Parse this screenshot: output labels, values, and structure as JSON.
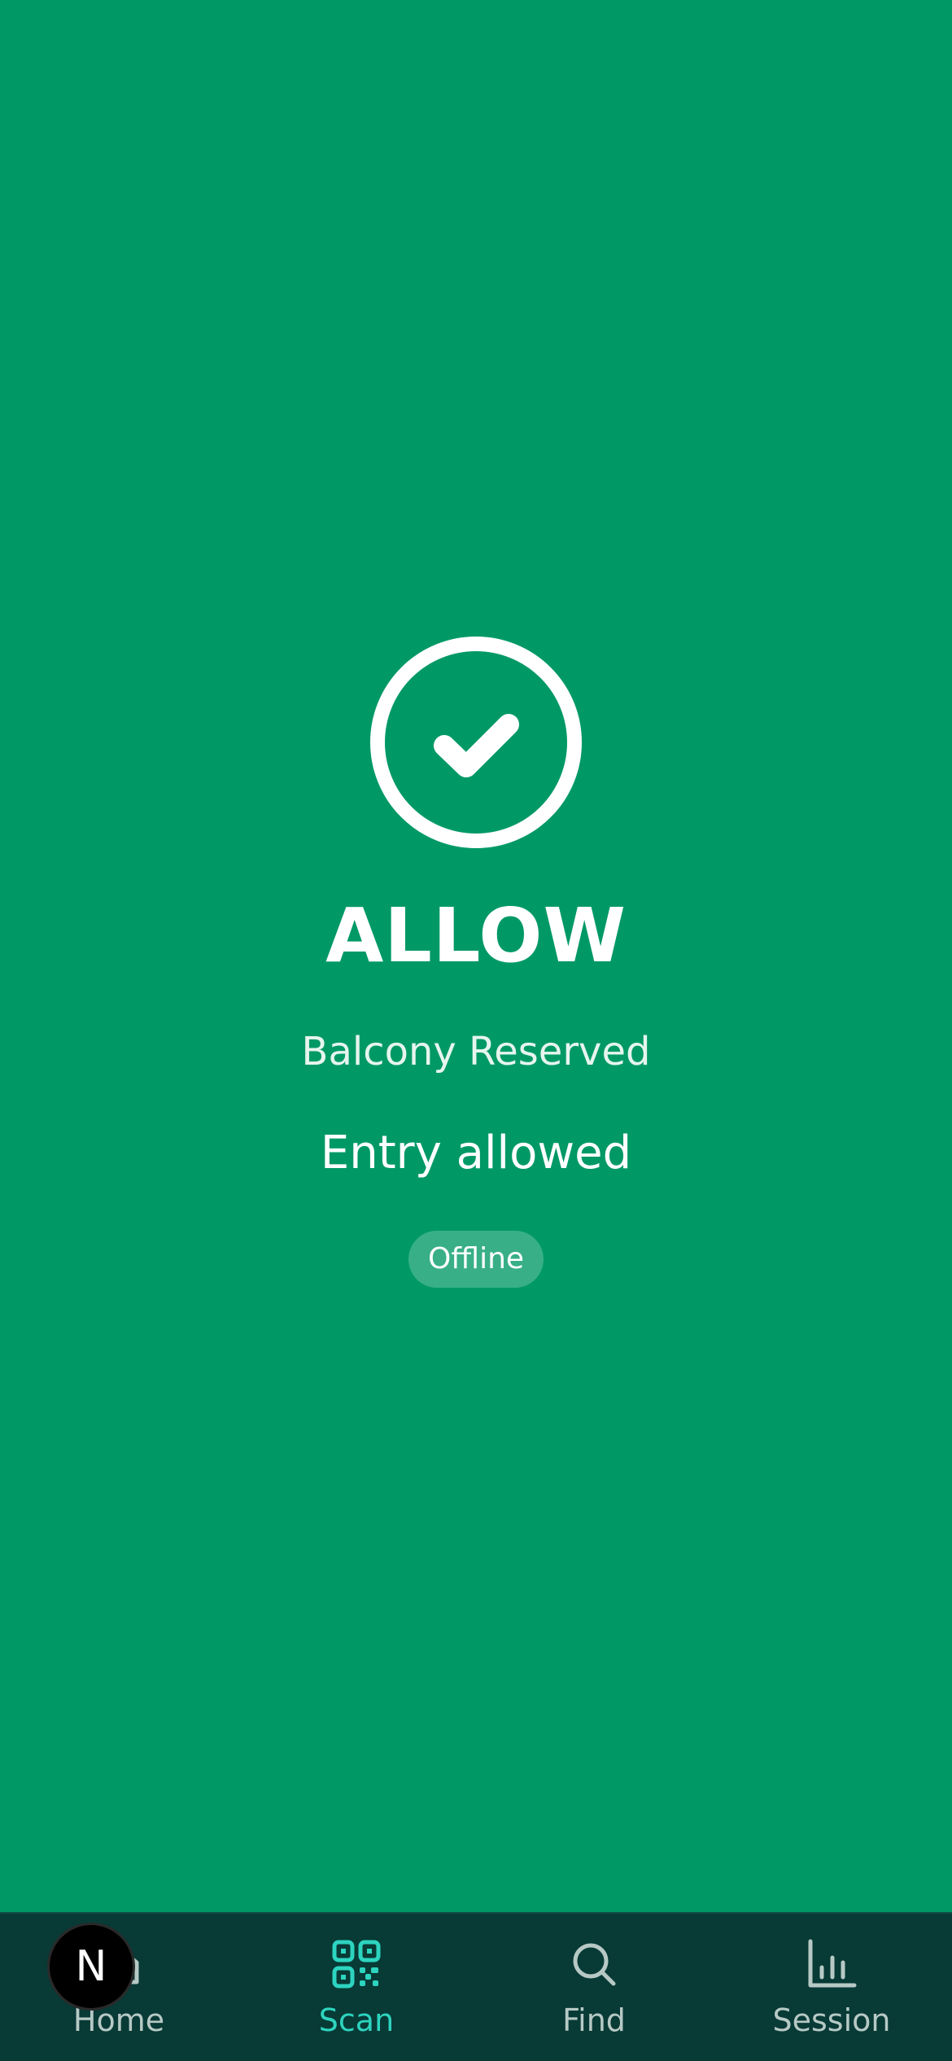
{
  "result": {
    "status": "ALLOW",
    "ticket_type": "Balcony Reserved",
    "message": "Entry allowed",
    "connection_badge": "Offline",
    "icon": "check-circle-icon",
    "background_color": "#009966"
  },
  "tab_bar": {
    "background_color": "#083a36",
    "active_color": "#2dd4bf",
    "inactive_color": "#b7c9c5",
    "tabs": [
      {
        "label": "Home",
        "icon": "home-icon",
        "active": false
      },
      {
        "label": "Scan",
        "icon": "qr-code-icon",
        "active": true
      },
      {
        "label": "Find",
        "icon": "search-icon",
        "active": false
      },
      {
        "label": "Session",
        "icon": "bar-chart-icon",
        "active": false
      }
    ]
  },
  "dev_badge": {
    "letter": "N",
    "icon": "nextjs-icon"
  }
}
